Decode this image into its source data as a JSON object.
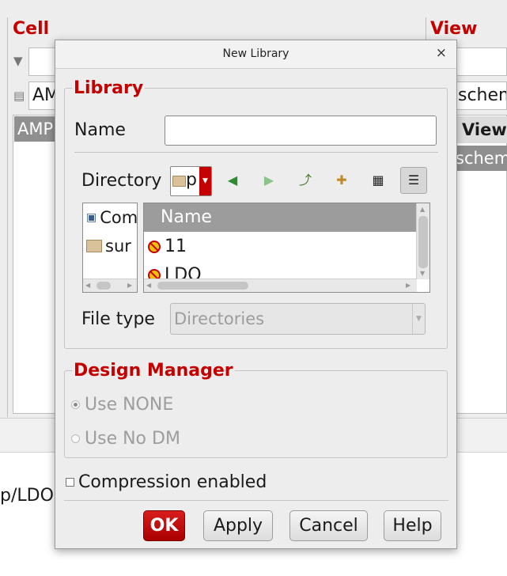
{
  "background": {
    "cell_header": "Cell",
    "view_header": "View",
    "cell_filter_value": "",
    "cell_name_value": "AM",
    "cell_list_selected": "AMP",
    "view_name_value": "schem",
    "view_list_header": "View",
    "view_list_selected": "schem",
    "log_text": "p/LDO."
  },
  "dialog": {
    "title": "New Library",
    "close_glyph": "×",
    "library_legend": "Library",
    "name_label": "Name",
    "name_value": "",
    "directory_label": "Directory",
    "directory_value": "p",
    "places": [
      {
        "label": "Com",
        "icon": "computer-icon"
      },
      {
        "label": "sur",
        "icon": "folder-icon"
      }
    ],
    "files_header": "Name",
    "files": [
      {
        "label": "11",
        "icon": "no-access-icon"
      },
      {
        "label": "LDO",
        "icon": "no-access-icon"
      }
    ],
    "file_type_label": "File type",
    "file_type_value": "Directories",
    "design_manager_legend": "Design Manager",
    "radio_use_none": "Use NONE",
    "radio_use_no_dm": "Use No DM",
    "selected_radio": "Use NONE",
    "compression_label": "Compression enabled",
    "compression_checked": false,
    "buttons": {
      "ok": "OK",
      "apply": "Apply",
      "cancel": "Cancel",
      "help": "Help"
    },
    "colors": {
      "accent": "#c40000",
      "selection": "#9c9c9c"
    }
  }
}
